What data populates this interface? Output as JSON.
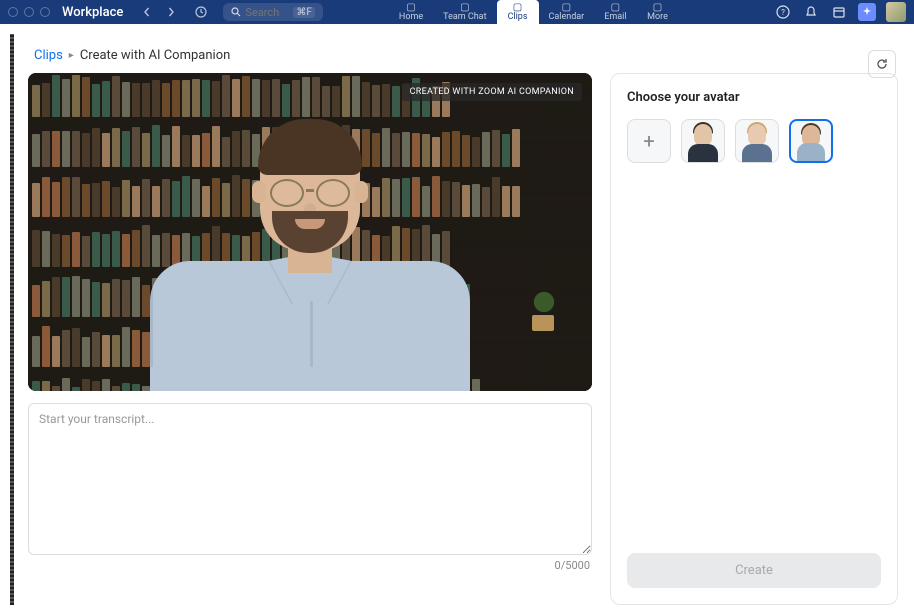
{
  "topbar": {
    "app_name": "Workplace",
    "search_placeholder": "Search",
    "search_shortcut": "⌘F"
  },
  "nav_tabs": [
    {
      "label": "Home",
      "icon": "home-icon"
    },
    {
      "label": "Team Chat",
      "icon": "chat-icon"
    },
    {
      "label": "Clips",
      "icon": "clips-icon",
      "active": true
    },
    {
      "label": "Calendar",
      "icon": "calendar-icon"
    },
    {
      "label": "Email",
      "icon": "email-icon"
    },
    {
      "label": "More",
      "icon": "more-icon"
    }
  ],
  "breadcrumb": {
    "parent": "Clips",
    "current": "Create with AI Companion"
  },
  "preview": {
    "badge": "CREATED WITH ZOOM AI COMPANION"
  },
  "transcript": {
    "placeholder": "Start your transcript...",
    "value": "",
    "max": 5000,
    "count_label": "0/5000"
  },
  "sidebar": {
    "title": "Choose your avatar",
    "avatars": [
      {
        "type": "add"
      },
      {
        "type": "avatar",
        "desc": "man-suit",
        "skin": "#e2c4a6",
        "hair": "#3a2e22",
        "body": "#2a3240"
      },
      {
        "type": "avatar",
        "desc": "woman-blonde",
        "skin": "#e8cab0",
        "hair": "#c8a86a",
        "body": "#5a7290"
      },
      {
        "type": "avatar",
        "desc": "man-blue-shirt",
        "skin": "#dcb898",
        "hair": "#4a3525",
        "body": "#9ab2c8",
        "selected": true
      }
    ],
    "create_label": "Create"
  },
  "colors": {
    "primary": "#0e71eb",
    "topbar_bg": "#1a3b7a"
  }
}
